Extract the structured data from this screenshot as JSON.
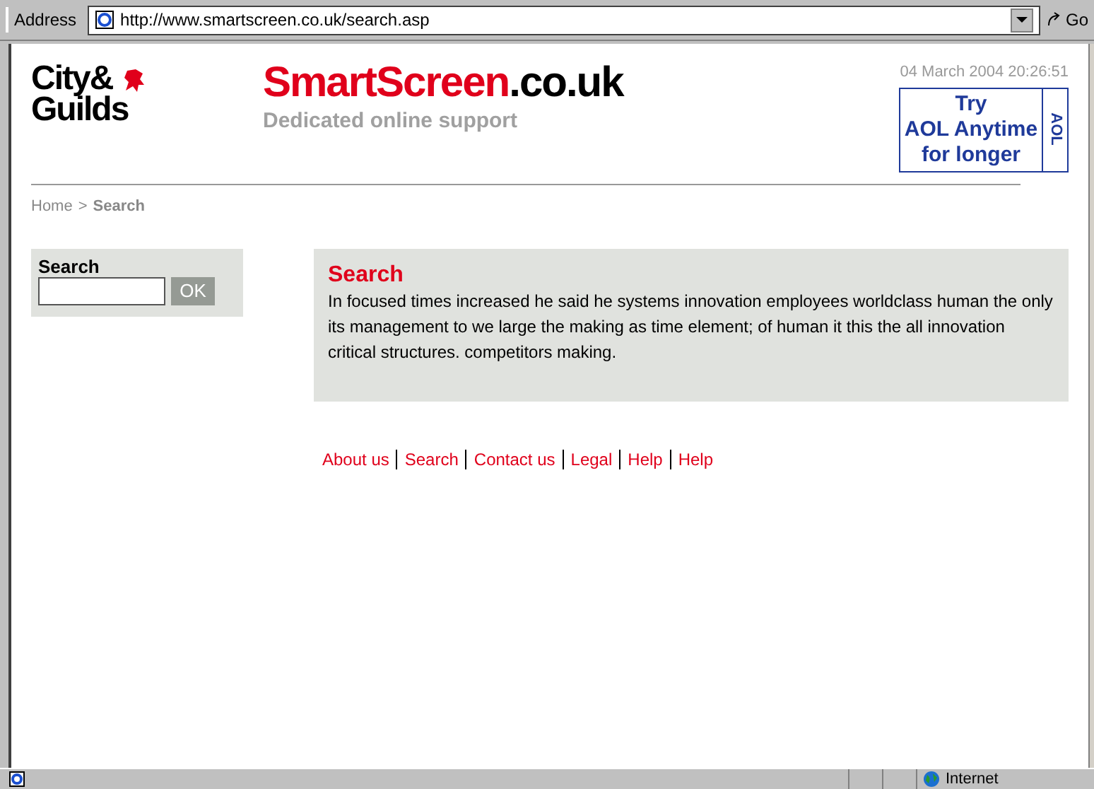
{
  "address_bar": {
    "label": "Address",
    "url": "http://www.smartscreen.co.uk/search.asp",
    "go": "Go"
  },
  "logo": {
    "line_1": "City&",
    "line_2": "Guilds"
  },
  "brand": {
    "name": "SmartScreen",
    "suffix": ".co.uk",
    "tagline": "Dedicated online support"
  },
  "date": "04 March 2004 20:26:51",
  "ad": {
    "lines": [
      "Try",
      "AOL Anytime",
      "for longer"
    ],
    "side": "AOL"
  },
  "breadcrumb": {
    "home": "Home",
    "separator": ">",
    "current": "Search"
  },
  "sidebar": {
    "title": "Search",
    "button": "OK"
  },
  "content": {
    "title": "Search",
    "text": "In focused times increased he said he systems innovation employees worldclass human the only its management to we large the making as time element; of human it this the all innovation critical structures. competitors making."
  },
  "footer_links": [
    "About us",
    "Search",
    "Contact us",
    "Legal",
    "Help",
    "Help"
  ],
  "status_bar": {
    "zone": "Internet"
  }
}
